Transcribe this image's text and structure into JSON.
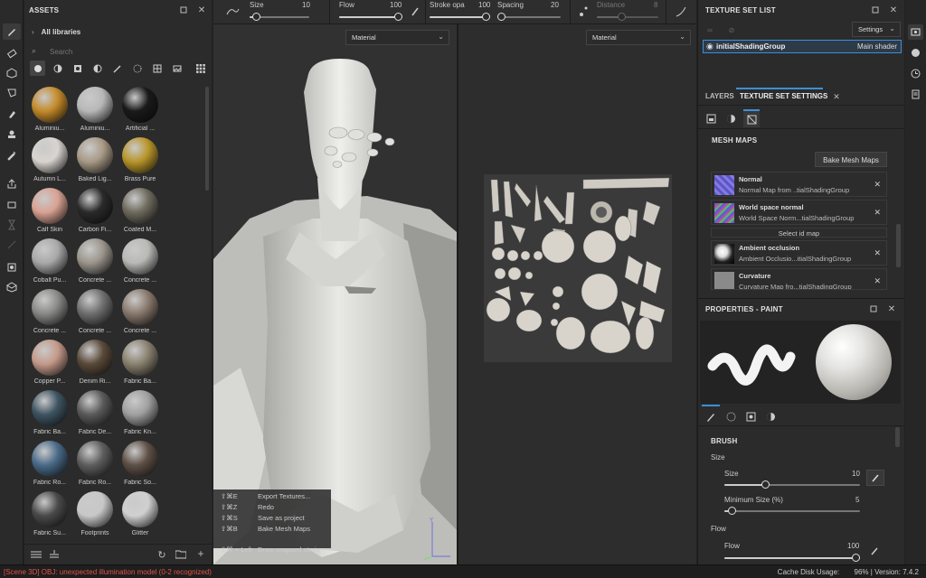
{
  "assets": {
    "title": "ASSETS",
    "all_libraries": "All libraries",
    "search_placeholder": "Search",
    "materials": [
      {
        "label": "Aluminiu...",
        "color": "#c48a2a"
      },
      {
        "label": "Aluminiu...",
        "color": "#b8b8b8"
      },
      {
        "label": "Artificial ...",
        "color": "#1a1a1a"
      },
      {
        "label": "Autumn L...",
        "color": "#d8d4cf"
      },
      {
        "label": "Baked Lig...",
        "color": "#a89a86"
      },
      {
        "label": "Brass Pure",
        "color": "#b8952a"
      },
      {
        "label": "Calf Skin",
        "color": "#d9a293"
      },
      {
        "label": "Carbon Fi...",
        "color": "#2a2a2a"
      },
      {
        "label": "Coated M...",
        "color": "#6e6a5e"
      },
      {
        "label": "Cobalt Pu...",
        "color": "#a9a9a9"
      },
      {
        "label": "Concrete ...",
        "color": "#9b958c"
      },
      {
        "label": "Concrete ...",
        "color": "#b9b9b6"
      },
      {
        "label": "Concrete ...",
        "color": "#8a8a88"
      },
      {
        "label": "Concrete ...",
        "color": "#707070"
      },
      {
        "label": "Concrete ...",
        "color": "#8a7a6e"
      },
      {
        "label": "Copper P...",
        "color": "#c49a8a"
      },
      {
        "label": "Denim Ri...",
        "color": "#5a4a3a"
      },
      {
        "label": "Fabric Ba...",
        "color": "#8a8270"
      },
      {
        "label": "Fabric Ba...",
        "color": "#3e5462"
      },
      {
        "label": "Fabric De...",
        "color": "#5a5a5a"
      },
      {
        "label": "Fabric Kn...",
        "color": "#a0a0a0"
      },
      {
        "label": "Fabric Ro...",
        "color": "#4a6a88"
      },
      {
        "label": "Fabric Ro...",
        "color": "#5e5e5e"
      },
      {
        "label": "Fabric So...",
        "color": "#5e5046"
      },
      {
        "label": "Fabric Su...",
        "color": "#4a4a4a"
      },
      {
        "label": "Footprints",
        "color": "#c8c8c8"
      },
      {
        "label": "Glitter",
        "color": "#d0d0d0"
      }
    ]
  },
  "toolbar": {
    "size_label": "Size",
    "size_value": "10",
    "size_frac": 0.1,
    "flow_label": "Flow",
    "flow_value": "100",
    "flow_frac": 1.0,
    "stroke_label": "Stroke opa",
    "stroke_value": "100",
    "stroke_frac": 1.0,
    "spacing_label": "Spacing",
    "spacing_value": "20",
    "spacing_frac": 0.05,
    "distance_label": "Distance",
    "distance_value": "8",
    "distance_frac": 0.4
  },
  "viewport": {
    "left_dropdown": "Material",
    "right_dropdown": "Material",
    "shortcuts": [
      {
        "keys": "⇧⌘E",
        "action": "Export Textures..."
      },
      {
        "keys": "⇧⌘Z",
        "action": "Redo"
      },
      {
        "keys": "⇧⌘S",
        "action": "Save as project"
      },
      {
        "keys": "⇧⌘B",
        "action": "Bake Mesh Maps"
      },
      {
        "keys": "⇧⌘ + Left",
        "action": "Draw snapped straig"
      }
    ]
  },
  "texture_set_list": {
    "title": "TEXTURE SET LIST",
    "settings": "Settings",
    "item_name": "initialShadingGroup",
    "item_shader": "Main shader"
  },
  "tabs": {
    "layers": "LAYERS",
    "tss": "TEXTURE SET SETTINGS"
  },
  "mesh_maps": {
    "title": "MESH MAPS",
    "bake_button": "Bake Mesh Maps",
    "select_id": "Select id map",
    "maps": [
      {
        "name": "Normal",
        "sub": "Normal Map from ..tialShadingGroup"
      },
      {
        "name": "World space normal",
        "sub": "World Space Norm...tialShadingGroup"
      },
      {
        "name": "Ambient occlusion",
        "sub": "Ambient Occlusio...itialShadingGroup"
      },
      {
        "name": "Curvature",
        "sub": "Curvature Map fro...tialShadingGroup"
      }
    ]
  },
  "properties": {
    "title": "PROPERTIES - PAINT",
    "brush": "BRUSH",
    "size_group": "Size",
    "size_label": "Size",
    "size_value": "10",
    "size_frac": 0.3,
    "min_size_label": "Minimum Size (%)",
    "min_size_value": "5",
    "min_size_frac": 0.05,
    "flow_group": "Flow",
    "flow_label": "Flow",
    "flow_value": "100",
    "flow_frac": 1.0
  },
  "status": {
    "message": "[Scene 3D] OBJ: unexpected illumination model (0-2 recognized)",
    "cache_label": "Cache Disk Usage:",
    "cache_value": "96%",
    "version": "| Version: 7.4.2"
  },
  "colors": {
    "error": "#e0534b",
    "accent": "#3d8fd6"
  }
}
